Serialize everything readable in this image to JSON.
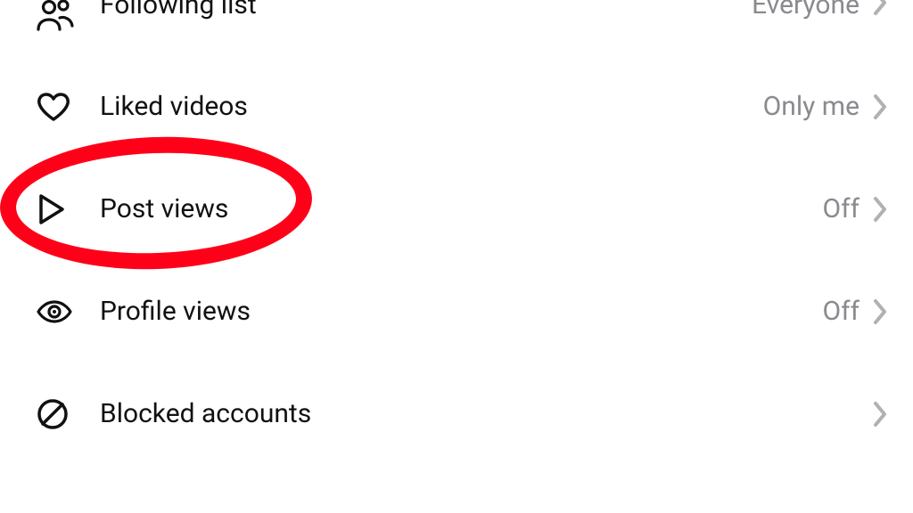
{
  "rows": {
    "followingList": {
      "label": "Following list",
      "value": "Everyone"
    },
    "likedVideos": {
      "label": "Liked videos",
      "value": "Only me"
    },
    "postViews": {
      "label": "Post views",
      "value": "Off"
    },
    "profileViews": {
      "label": "Profile views",
      "value": "Off"
    },
    "blockedAccounts": {
      "label": "Blocked accounts",
      "value": ""
    }
  },
  "annotation": {
    "highlightTarget": "post-views-row"
  }
}
